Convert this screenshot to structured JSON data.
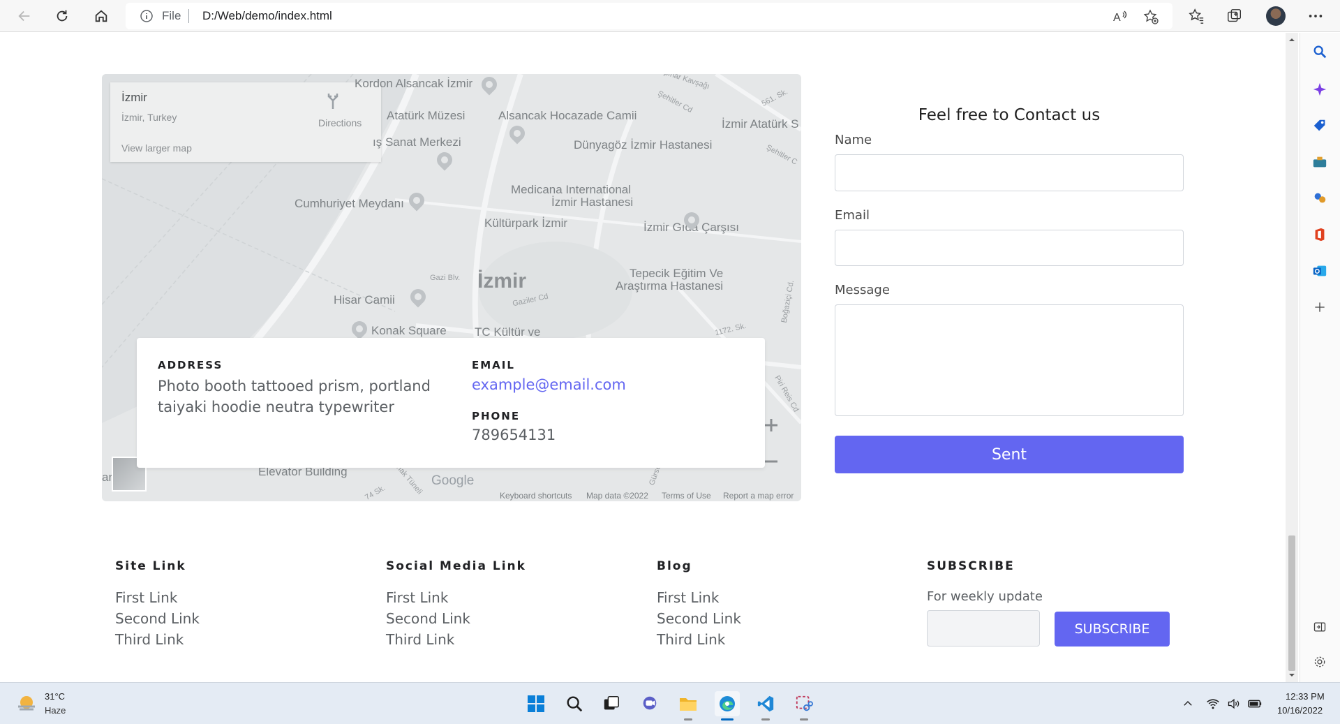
{
  "browser": {
    "address_prefix": "File",
    "url": "D:/Web/demo/index.html",
    "icons": [
      "back-icon",
      "refresh-icon",
      "home-icon",
      "info-icon",
      "read-aloud-icon",
      "add-favorite-icon",
      "favorites-icon",
      "collections-icon",
      "profile-avatar",
      "more-icon"
    ]
  },
  "sidebar_icons": [
    "search-icon",
    "copilot-icon",
    "shopping-icon",
    "tools-icon",
    "games-icon",
    "office-icon",
    "outlook-icon",
    "add-icon",
    "split-screen-icon",
    "settings-icon"
  ],
  "map": {
    "place_name": "İzmir",
    "place_region": "İzmir, Turkey",
    "view_larger": "View larger map",
    "directions": "Directions",
    "city_label": "İzmir",
    "labels": {
      "kordon": "Kordon Alsancak İzmir",
      "ataturk_muzesi": "Atatürk Müzesi",
      "alsancak_hoca": "Alsancak Hocazade Camii",
      "sanat": "ış Sanat Merkezi",
      "dunyagoz": "Dünyagöz İzmir Hastanesi",
      "ataturk_s": "İzmir Atatürk S",
      "cumhuriyet": "Cumhuriyet Meydanı",
      "medicana": "Medicana International",
      "medicana2": "İzmir Hastanesi",
      "kulturpark": "Kültürpark İzmir",
      "gida": "İzmir Gıda Çarşısı",
      "tepecik": "Tepecik Eğitim Ve",
      "tepecik2": "Araştırma Hastanesi",
      "hisar": "Hisar Camii",
      "konak": "Konak Square",
      "tc_kultur": "TC Kültür ve",
      "elevator": "Elevator Building",
      "ar": "ar"
    },
    "streets": {
      "kavsagi": "pınar Kavşağı",
      "sehitler1": "Şehitler Cd",
      "sk561": "561. Sk.",
      "sehitler2": "Şehitler C",
      "gazi": "Gazi Blv.",
      "gaziler": "Gaziler Cd",
      "sk1172": "1172. Sk.",
      "bogazici": "Boğaziçi Cd.",
      "piri": "Piri Reis Cd",
      "tuneli": "Konak Tüneli",
      "sk74": "74 Sk.",
      "gurses": "Gürses"
    },
    "google": "Google",
    "footer": {
      "shortcuts": "Keyboard shortcuts",
      "data": "Map data ©2022",
      "terms": "Terms of Use",
      "report": "Report a map error"
    }
  },
  "contact_card": {
    "address_label": "ADDRESS",
    "address_text": "Photo booth tattooed prism, portland taiyaki hoodie neutra typewriter",
    "email_label": "EMAIL",
    "email": "example@email.com",
    "phone_label": "PHONE",
    "phone": "789654131"
  },
  "form": {
    "title": "Feel free to Contact us",
    "name_label": "Name",
    "email_label": "Email",
    "message_label": "Message",
    "submit": "Sent"
  },
  "footer": {
    "columns": [
      {
        "title": "Site Link",
        "links": [
          "First Link",
          "Second Link",
          "Third Link"
        ]
      },
      {
        "title": "Social Media Link",
        "links": [
          "First Link",
          "Second Link",
          "Third Link"
        ]
      },
      {
        "title": "Blog",
        "links": [
          "First Link",
          "Second Link",
          "Third Link"
        ]
      }
    ],
    "subscribe_title": "SUBSCRIBE",
    "subscribe_text": "For weekly update",
    "subscribe_button": "SUBSCRIBE"
  },
  "taskbar": {
    "temperature": "31°C",
    "weather": "Haze",
    "apps": [
      "start-icon",
      "search-icon",
      "task-view-icon",
      "chat-icon",
      "file-explorer-icon",
      "edge-icon",
      "vscode-icon",
      "snipping-tool-icon"
    ],
    "time": "12:33 PM",
    "date": "10/16/2022"
  },
  "colors": {
    "accent": "#6366f1",
    "map_bg": "#e5e7e8"
  }
}
